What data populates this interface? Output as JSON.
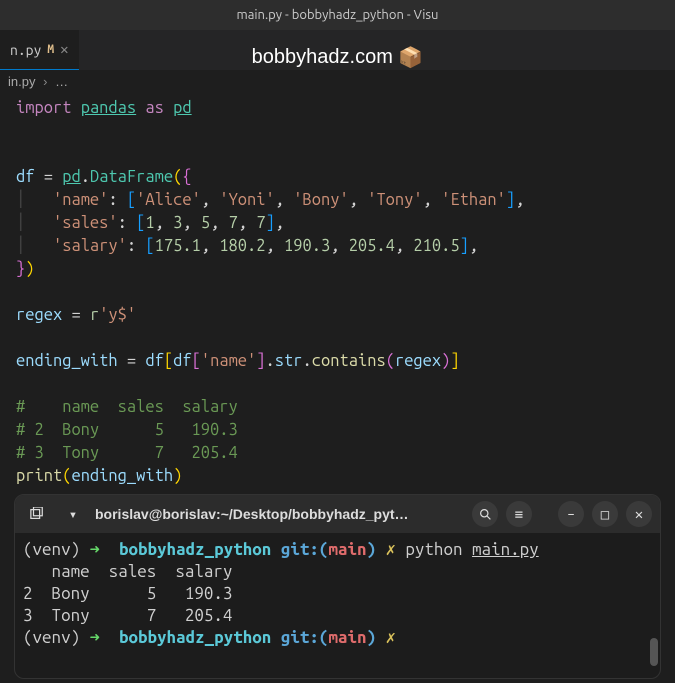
{
  "window": {
    "title": "main.py - bobbyhadz_python - Visu"
  },
  "tab": {
    "name": "n.py",
    "modified": "M",
    "close": "✕"
  },
  "watermark": {
    "text": "bobbyhadz.com",
    "icon": "📦"
  },
  "breadcrumb": {
    "file": "in.py",
    "sep": "›",
    "more": "…"
  },
  "code": {
    "l1_import": "import",
    "l1_pandas": "pandas",
    "l1_as": "as",
    "l1_pd": "pd",
    "l2_df": "df",
    "l2_eq": " = ",
    "l2_pd": "pd",
    "l2_dot": ".",
    "l2_DataFrame": "DataFrame",
    "l2_op": "(",
    "l2_br": "{",
    "l3_key": "'name'",
    "l3_colon": ": ",
    "l3_lb": "[",
    "l3_v1": "'Alice'",
    "l3_v2": "'Yoni'",
    "l3_v3": "'Bony'",
    "l3_v4": "'Tony'",
    "l3_v5": "'Ethan'",
    "l3_rb": "]",
    "l3_comma": ",",
    "l4_key": "'sales'",
    "l4_lb": "[",
    "l4_v1": "1",
    "l4_v2": "3",
    "l4_v3": "5",
    "l4_v4": "7",
    "l4_v5": "7",
    "l4_rb": "]",
    "l5_key": "'salary'",
    "l5_lb": "[",
    "l5_v1": "175.1",
    "l5_v2": "180.2",
    "l5_v3": "190.3",
    "l5_v4": "205.4",
    "l5_v5": "210.5",
    "l5_rb": "]",
    "l6_rbr": "}",
    "l6_rp": ")",
    "l7_regex": "regex",
    "l7_eq": " = ",
    "l7_r": "r",
    "l7_str": "'y$'",
    "l8_var": "ending_with",
    "l8_eq": " = ",
    "l8_df": "df",
    "l8_lb1": "[",
    "l8_df2": "df",
    "l8_lb2": "[",
    "l8_name": "'name'",
    "l8_rb2": "]",
    "l8_dot1": ".",
    "l8_str": "str",
    "l8_dot2": ".",
    "l8_contains": "contains",
    "l8_lp": "(",
    "l8_arg": "regex",
    "l8_rp": ")",
    "l8_rb1": "]",
    "c1": "#    name  sales  salary",
    "c2": "# 2  Bony      5   190.3",
    "c3": "# 3  Tony      7   205.4",
    "l9_print": "print",
    "l9_lp": "(",
    "l9_arg": "ending_with",
    "l9_rp": ")"
  },
  "terminal": {
    "title": "borislav@borislav:~/Desktop/bobbyhadz_pyt…",
    "venv": "(venv)",
    "arrow": "➜",
    "path": "bobbyhadz_python",
    "git": "git:",
    "lp": "(",
    "branch": "main",
    "rp": ")",
    "x": "✗",
    "cmd_python": "python",
    "cmd_file": "main.py",
    "out1": "   name  sales  salary",
    "out2": "2  Bony      5   190.3",
    "out3": "3  Tony      7   205.4"
  }
}
